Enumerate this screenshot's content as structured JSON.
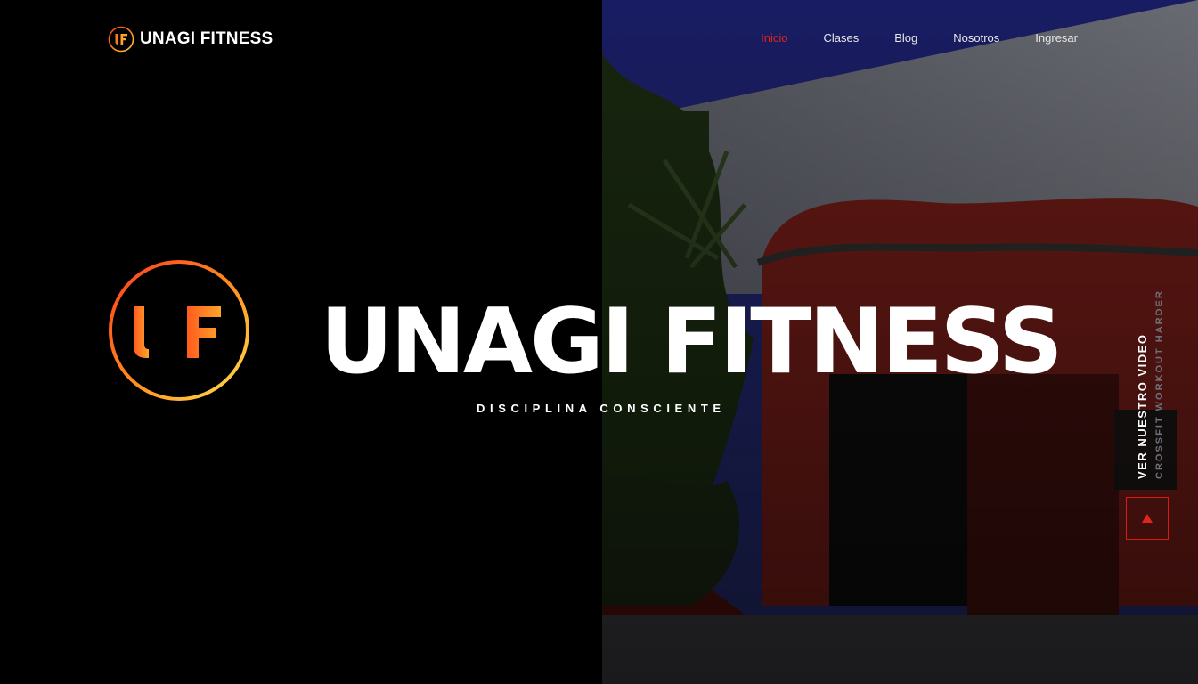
{
  "brand": {
    "name": "UNAGI FITNESS",
    "mark_icon": "unagi-fitness-logo-icon"
  },
  "nav": {
    "items": [
      {
        "label": "Inicio",
        "active": true
      },
      {
        "label": "Clases"
      },
      {
        "label": "Blog"
      },
      {
        "label": "Nosotros"
      },
      {
        "label": "Ingresar"
      }
    ]
  },
  "hero": {
    "title": "UNAGI FITNESS",
    "subtitle": "DISCIPLINA CONSCIENTE"
  },
  "side": {
    "video_label": "VER NUESTRO VIDEO",
    "tagline": "CROSSFIT WORKOUT HARDER",
    "scroll_top_icon": "triangle-up-icon"
  },
  "colors": {
    "accent": "#e0251c",
    "logo_gradient": [
      "#ff3d1f",
      "#ff8a1d",
      "#ffd23e"
    ]
  }
}
